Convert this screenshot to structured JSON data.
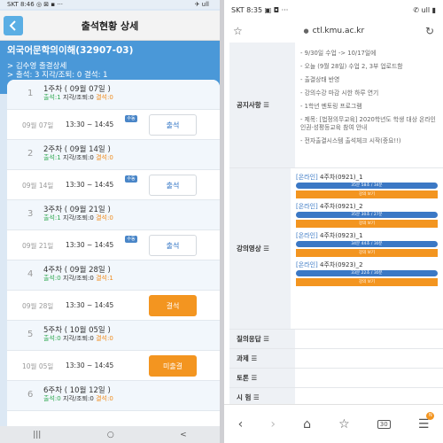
{
  "left": {
    "status": {
      "time": "SKT 8:46",
      "icons": "◎ ⊠ ▪ ···",
      "right": "✈ ull"
    },
    "header": {
      "title": "출석현황 상세",
      "back_icon": "chevron-left"
    },
    "course": {
      "name": "외국어문학의이해(32907-03)",
      "student_line": "> 김수영 출결상세",
      "summary_line": "> 출석: 3  지각/조퇴: 0  결석: 1"
    },
    "weeks": [
      {
        "num": "1",
        "title": "1주차 ( 09월 07일 )",
        "attend": "출석:1",
        "late": "지각/조퇴:0",
        "absent": "결석:0",
        "session": {
          "date": "09월 07일",
          "time": "13:30 ~ 14:45",
          "badge": "수동",
          "button": "출석",
          "status": "present"
        }
      },
      {
        "num": "2",
        "title": "2주차 ( 09월 14일 )",
        "attend": "출석:1",
        "late": "지각/조퇴:0",
        "absent": "결석:0",
        "session": {
          "date": "09월 14일",
          "time": "13:30 ~ 14:45",
          "badge": "수동",
          "button": "출석",
          "status": "present"
        }
      },
      {
        "num": "3",
        "title": "3주차 ( 09월 21일 )",
        "attend": "출석:1",
        "late": "지각/조퇴:0",
        "absent": "결석:0",
        "session": {
          "date": "09월 21일",
          "time": "13:30 ~ 14:45",
          "badge": "수동",
          "button": "출석",
          "status": "present"
        }
      },
      {
        "num": "4",
        "title": "4주차 ( 09월 28일 )",
        "attend": "출석:0",
        "late": "지각/조퇴:0",
        "absent": "결석:1",
        "session": {
          "date": "09월 28일",
          "time": "13:30 ~ 14:45",
          "badge": "",
          "button": "결석",
          "status": "absent"
        }
      },
      {
        "num": "5",
        "title": "5주차 ( 10월 05일 )",
        "attend": "출석:0",
        "late": "지각/조퇴:0",
        "absent": "결석:0",
        "session": {
          "date": "10월 05일",
          "time": "13:30 ~ 14:45",
          "badge": "",
          "button": "미출결",
          "status": "missing"
        }
      },
      {
        "num": "6",
        "title": "6주차 ( 10월 12일 )",
        "attend": "출석:0",
        "late": "지각/조퇴:0",
        "absent": "결석:0"
      }
    ],
    "nav": {
      "recent": "|||",
      "home": "○",
      "back": "<"
    }
  },
  "right": {
    "status": {
      "time": "SKT 8:35",
      "icons": "▣ ◘ ···",
      "right": "✆ ull ▮"
    },
    "url": "ctl.kmu.ac.kr",
    "notices_label": "공지사항",
    "notices": [
      "- 9/30일 수업 -> 10/17일에",
      "- 오늘 (9월 28일) 수업 2, 3부 업로드함",
      "- 출결상태 반영",
      "- 강의수강 마감 시한 하루 연기",
      "- 1학년 멘토링 프로그램",
      "- 제목: [법정의무교육] 2020학년도 학생 대상 온라인 인권·성평등교육 참여 안내",
      "- 전자출결시스템 출석체크 시작(중요!!)"
    ],
    "videos_label": "강의영상",
    "videos": [
      {
        "tag": "[온라인]",
        "title": "4주차(0921)_1",
        "progress": "35분 58초 / 34분",
        "watch": "강의 보기"
      },
      {
        "tag": "[온라인]",
        "title": "4주차(0921)_2",
        "progress": "35분 30초 / 27분",
        "watch": "강의 보기"
      },
      {
        "tag": "[온라인]",
        "title": "4주차(0923)_1",
        "progress": "34분 44초 / 30분",
        "watch": "강의 보기"
      },
      {
        "tag": "[온라인]",
        "title": "4주차(0923)_2",
        "progress": "33분 22초 / 30분",
        "watch": "강의 보기"
      }
    ],
    "sections": [
      "질의응답",
      "과제",
      "토론",
      "시 험"
    ],
    "nav": {
      "tab_count": "30",
      "notif": "N"
    }
  },
  "colors": {
    "left_bg": "#dce8f4",
    "course_bar": "#4a98d8",
    "present_text": "#2f73c4",
    "attend_green": "#2fa84f",
    "absent_orange": "#f08c1e",
    "button_orange": "#f39520",
    "progress_blue": "#3b78c5"
  }
}
